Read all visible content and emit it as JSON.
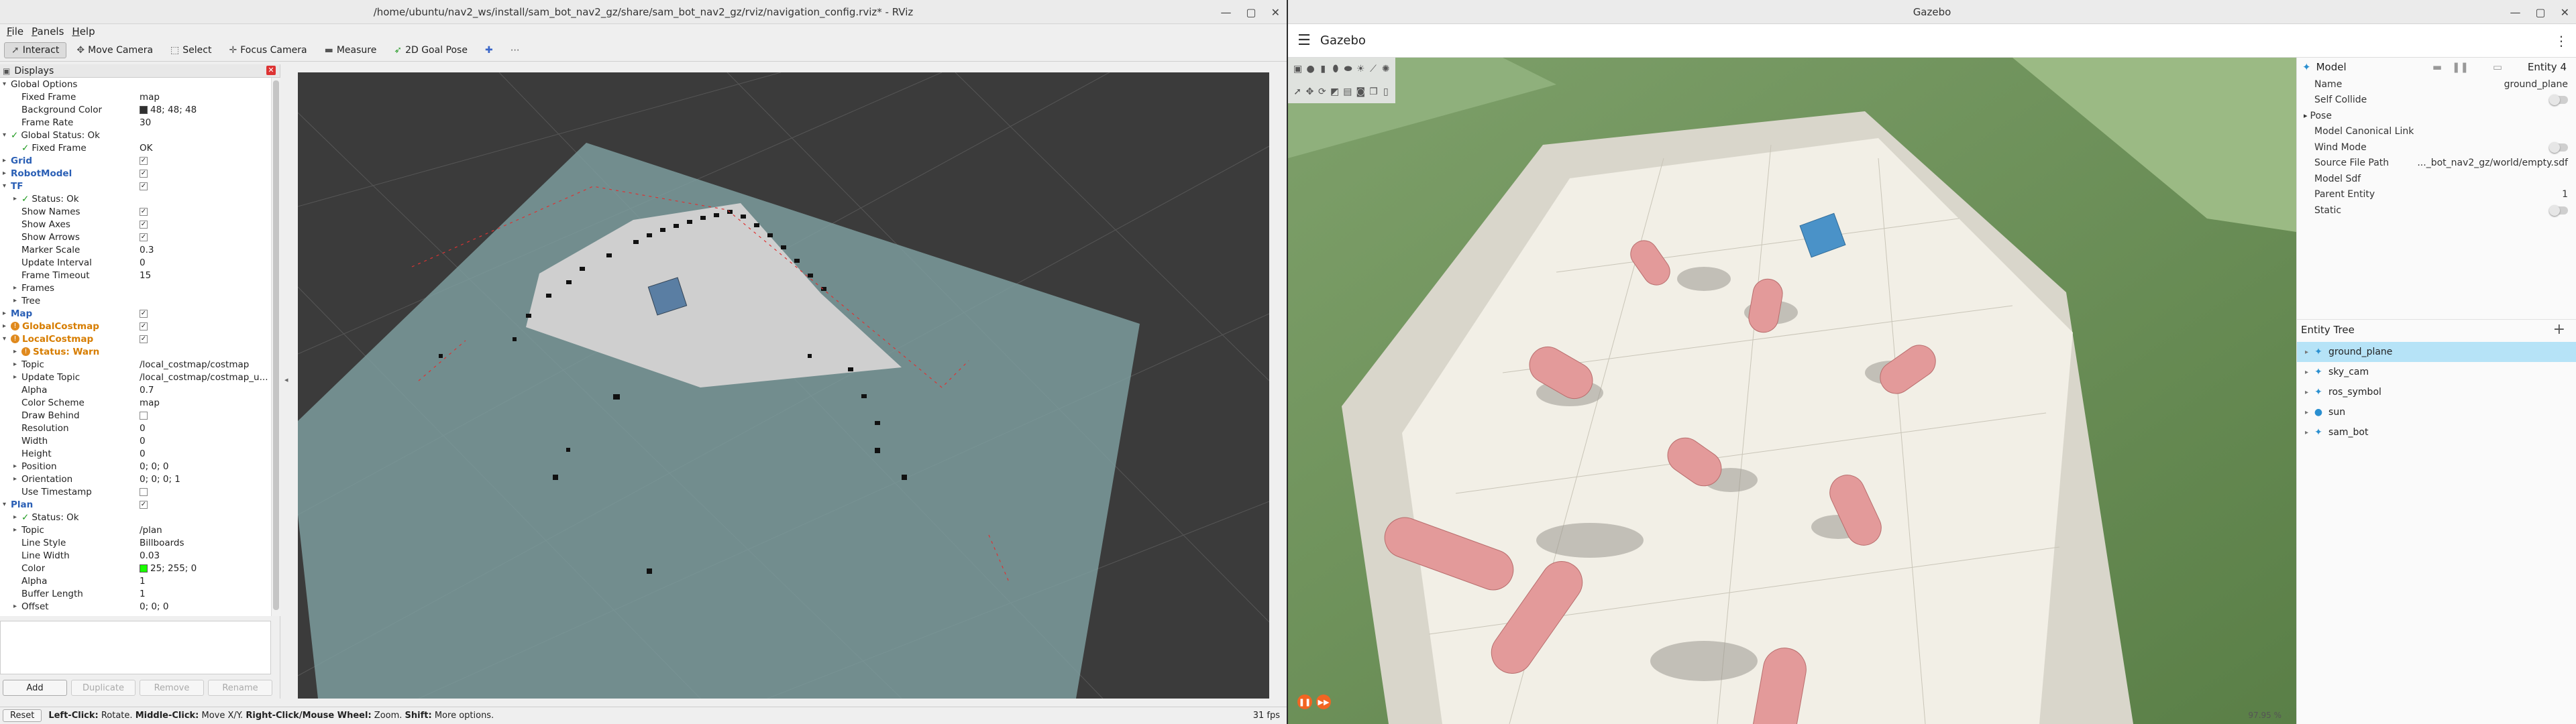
{
  "rviz": {
    "title": "/home/ubuntu/nav2_ws/install/sam_bot_nav2_gz/share/sam_bot_nav2_gz/rviz/navigation_config.rviz* - RViz",
    "menu": [
      "File",
      "Panels",
      "Help"
    ],
    "tools": [
      {
        "label": "Interact",
        "icon": "cursor-icon"
      },
      {
        "label": "Move Camera",
        "icon": "move-camera-icon"
      },
      {
        "label": "Select",
        "icon": "select-icon"
      },
      {
        "label": "Focus Camera",
        "icon": "focus-camera-icon"
      },
      {
        "label": "Measure",
        "icon": "measure-icon"
      },
      {
        "label": "2D Goal Pose",
        "icon": "goal-pose-icon"
      }
    ],
    "displays_title": "Displays",
    "tree": [
      {
        "name": "Global Options",
        "indent": 0,
        "arrow": "▾",
        "icon": "gear-icon"
      },
      {
        "name": "Fixed Frame",
        "indent": 1,
        "value": "map"
      },
      {
        "name": "Background Color",
        "indent": 1,
        "value": "48; 48; 48",
        "swatch": "#303030"
      },
      {
        "name": "Frame Rate",
        "indent": 1,
        "value": "30"
      },
      {
        "name": "Global Status: Ok",
        "indent": 0,
        "arrow": "▾",
        "status": "ok"
      },
      {
        "name": "Fixed Frame",
        "indent": 1,
        "value": "OK",
        "status": "ok"
      },
      {
        "name": "Grid",
        "indent": 0,
        "arrow": "▸",
        "style": "blue",
        "check": true
      },
      {
        "name": "RobotModel",
        "indent": 0,
        "arrow": "▸",
        "style": "blue",
        "check": true
      },
      {
        "name": "TF",
        "indent": 0,
        "arrow": "▾",
        "style": "blue",
        "check": true
      },
      {
        "name": "Status: Ok",
        "indent": 1,
        "arrow": "▸",
        "status": "ok"
      },
      {
        "name": "Show Names",
        "indent": 1,
        "check": true
      },
      {
        "name": "Show Axes",
        "indent": 1,
        "check": true
      },
      {
        "name": "Show Arrows",
        "indent": 1,
        "check": true
      },
      {
        "name": "Marker Scale",
        "indent": 1,
        "value": "0.3"
      },
      {
        "name": "Update Interval",
        "indent": 1,
        "value": "0"
      },
      {
        "name": "Frame Timeout",
        "indent": 1,
        "value": "15"
      },
      {
        "name": "Frames",
        "indent": 1,
        "arrow": "▸"
      },
      {
        "name": "Tree",
        "indent": 1,
        "arrow": "▸"
      },
      {
        "name": "Map",
        "indent": 0,
        "arrow": "▸",
        "style": "blue",
        "check": true
      },
      {
        "name": "GlobalCostmap",
        "indent": 0,
        "arrow": "▸",
        "style": "orange",
        "status": "warn",
        "check": true
      },
      {
        "name": "LocalCostmap",
        "indent": 0,
        "arrow": "▾",
        "style": "orange",
        "status": "warn",
        "check": true
      },
      {
        "name": "Status: Warn",
        "indent": 1,
        "arrow": "▸",
        "status": "warn",
        "style": "orange-text"
      },
      {
        "name": "Topic",
        "indent": 1,
        "arrow": "▸",
        "value": "/local_costmap/costmap"
      },
      {
        "name": "Update Topic",
        "indent": 1,
        "arrow": "▸",
        "value": "/local_costmap/costmap_u..."
      },
      {
        "name": "Alpha",
        "indent": 1,
        "value": "0.7"
      },
      {
        "name": "Color Scheme",
        "indent": 1,
        "value": "map"
      },
      {
        "name": "Draw Behind",
        "indent": 1,
        "check": false
      },
      {
        "name": "Resolution",
        "indent": 1,
        "value": "0"
      },
      {
        "name": "Width",
        "indent": 1,
        "value": "0"
      },
      {
        "name": "Height",
        "indent": 1,
        "value": "0"
      },
      {
        "name": "Position",
        "indent": 1,
        "arrow": "▸",
        "value": "0; 0; 0"
      },
      {
        "name": "Orientation",
        "indent": 1,
        "arrow": "▸",
        "value": "0; 0; 0; 1"
      },
      {
        "name": "Use Timestamp",
        "indent": 1,
        "check": false
      },
      {
        "name": "Plan",
        "indent": 0,
        "arrow": "▾",
        "style": "blue",
        "check": true
      },
      {
        "name": "Status: Ok",
        "indent": 1,
        "arrow": "▸",
        "status": "ok"
      },
      {
        "name": "Topic",
        "indent": 1,
        "arrow": "▸",
        "value": "/plan"
      },
      {
        "name": "Line Style",
        "indent": 1,
        "value": "Billboards"
      },
      {
        "name": "Line Width",
        "indent": 1,
        "value": "0.03"
      },
      {
        "name": "Color",
        "indent": 1,
        "value": "25; 255; 0",
        "swatch": "#19ff00"
      },
      {
        "name": "Alpha",
        "indent": 1,
        "value": "1"
      },
      {
        "name": "Buffer Length",
        "indent": 1,
        "value": "1"
      },
      {
        "name": "Offset",
        "indent": 1,
        "arrow": "▸",
        "value": "0; 0; 0"
      }
    ],
    "buttons": {
      "add": "Add",
      "duplicate": "Duplicate",
      "remove": "Remove",
      "rename": "Rename"
    },
    "status": {
      "reset": "Reset",
      "hint_lc": "Left-Click:",
      "hint_lc_v": "Rotate.",
      "hint_mc": "Middle-Click:",
      "hint_mc_v": "Move X/Y.",
      "hint_rc": "Right-Click/Mouse Wheel:",
      "hint_rc_v": "Zoom.",
      "hint_sh": "Shift:",
      "hint_sh_v": "More options.",
      "fps": "31 fps"
    }
  },
  "gazebo": {
    "title": "Gazebo",
    "header_title": "Gazebo",
    "component": {
      "title": "Model",
      "entity": "Entity 4",
      "props": [
        {
          "label": "Name",
          "value": "ground_plane"
        },
        {
          "label": "Self Collide",
          "toggle": true
        },
        {
          "label": "Pose",
          "arrow": true
        },
        {
          "label": "Model Canonical Link"
        },
        {
          "label": "Wind Mode",
          "toggle": true
        },
        {
          "label": "Source File Path",
          "value": "..._bot_nav2_gz/world/empty.sdf"
        },
        {
          "label": "Model Sdf"
        },
        {
          "label": "Parent Entity",
          "value": "1"
        },
        {
          "label": "Static",
          "toggle": true
        }
      ]
    },
    "entity_tree_title": "Entity Tree",
    "entities": [
      "ground_plane",
      "sky_cam",
      "ros_symbol",
      "sun",
      "sam_bot"
    ],
    "rtf": "97.95 %",
    "colors": {
      "accent": "#f26522",
      "selected": "#b6e3f7",
      "ground": "#6a9457",
      "pillar": "#e08a8a"
    }
  }
}
